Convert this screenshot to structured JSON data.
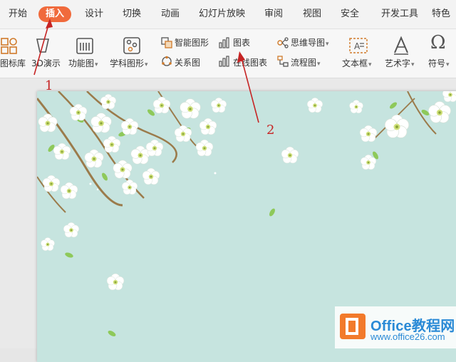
{
  "menu_tabs": [
    "开始",
    "插入",
    "设计",
    "切换",
    "动画",
    "幻灯片放映",
    "审阅",
    "视图",
    "安全",
    "开发工具",
    "特色"
  ],
  "active_tab": "插入",
  "ribbon": {
    "icon_library": "图标库",
    "demo_3d": "3D演示",
    "function_chart": "功能图",
    "subject_graphic": "学科图形",
    "smart_shape": "智能图形",
    "chart": "图表",
    "relation_chart": "关系图",
    "online_chart": "在线图表",
    "mind_map": "思维导图",
    "flowchart": "流程图",
    "textbox": "文本框",
    "art_text": "艺术字",
    "symbol": "符号"
  },
  "annotations": {
    "step1": "1",
    "step2": "2"
  },
  "watermark": {
    "brand": "Office教程网",
    "url": "www.office26.com"
  },
  "colors": {
    "active_tab": "#f06a3c",
    "slide_bg": "#c6e4df",
    "annotation": "#c62424",
    "watermark": "#2a8ad6"
  }
}
